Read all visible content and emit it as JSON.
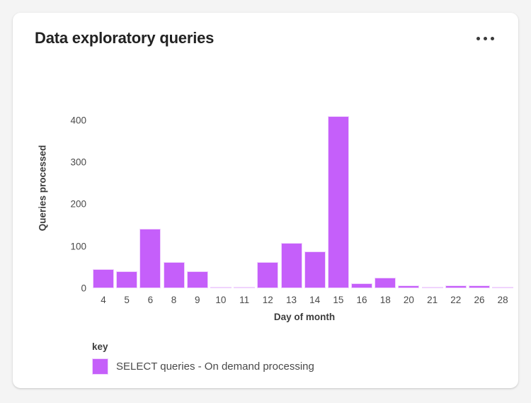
{
  "card": {
    "title": "Data exploratory queries",
    "more_menu_icon": "ellipsis-horizontal-icon",
    "background": "#ffffff"
  },
  "theme": {
    "page_background": "#f4f4f4",
    "accent": "#c55ffa",
    "bar_border": "#f0d4fd",
    "title_color": "#222222",
    "axis_text_color": "#4a4a4a"
  },
  "chart_data": {
    "type": "bar",
    "title": "Data exploratory queries",
    "xlabel": "Day of month",
    "ylabel": "Queries processed",
    "categories": [
      "4",
      "5",
      "6",
      "8",
      "9",
      "10",
      "11",
      "12",
      "13",
      "14",
      "15",
      "16",
      "18",
      "20",
      "21",
      "22",
      "26",
      "28"
    ],
    "values": [
      45,
      40,
      142,
      63,
      40,
      3,
      3,
      62,
      108,
      87,
      410,
      12,
      26,
      7,
      4,
      7,
      6,
      2
    ],
    "series": [
      {
        "name": "SELECT queries - On demand processing",
        "color": "#c55ffa",
        "values": [
          45,
          40,
          142,
          63,
          40,
          3,
          3,
          62,
          108,
          87,
          410,
          12,
          26,
          7,
          4,
          7,
          6,
          2
        ]
      }
    ],
    "ylim": [
      0,
      430
    ],
    "yticks": [
      0,
      100,
      200,
      300,
      400
    ],
    "ytick_labels": [
      "0",
      "100",
      "200",
      "300",
      "400"
    ],
    "grid": false,
    "legend_position": "bottom-left",
    "legend_title": "key"
  }
}
